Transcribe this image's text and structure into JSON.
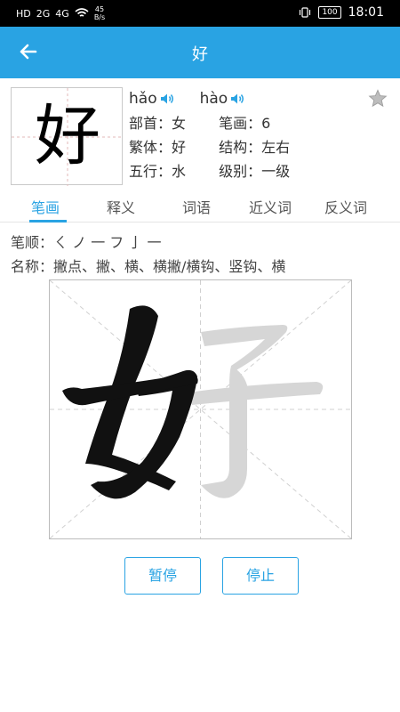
{
  "status": {
    "left_icons": [
      "HD",
      "2G",
      "4G",
      "wifi-icon"
    ],
    "speed_value": "45",
    "speed_unit": "B/s",
    "battery": "100",
    "time": "18:01"
  },
  "appbar": {
    "title": "好"
  },
  "char": {
    "glyph": "好",
    "pinyin": [
      "hǎo",
      "hào"
    ],
    "info": {
      "radical_label": "部首：",
      "radical": "女",
      "strokes_label": "笔画：",
      "strokes": "6",
      "traditional_label": "繁体：",
      "traditional": "好",
      "structure_label": "结构：",
      "structure": "左右",
      "element_label": "五行：",
      "element": "水",
      "level_label": "级别：",
      "level": "一级"
    }
  },
  "tabs": [
    "笔画",
    "释义",
    "词语",
    "近义词",
    "反义词"
  ],
  "strokes_section": {
    "order_label": "笔顺：",
    "order": "ㄑ ノ 一 フ 亅 一",
    "names_label": "名称：",
    "names": "撇点、撇、横、横撇/横钩、竖钩、横"
  },
  "buttons": {
    "pause": "暂停",
    "stop": "停止"
  },
  "colors": {
    "accent": "#29a3e3",
    "stroke_done": "#111111",
    "stroke_pending": "#d6d6d6"
  }
}
